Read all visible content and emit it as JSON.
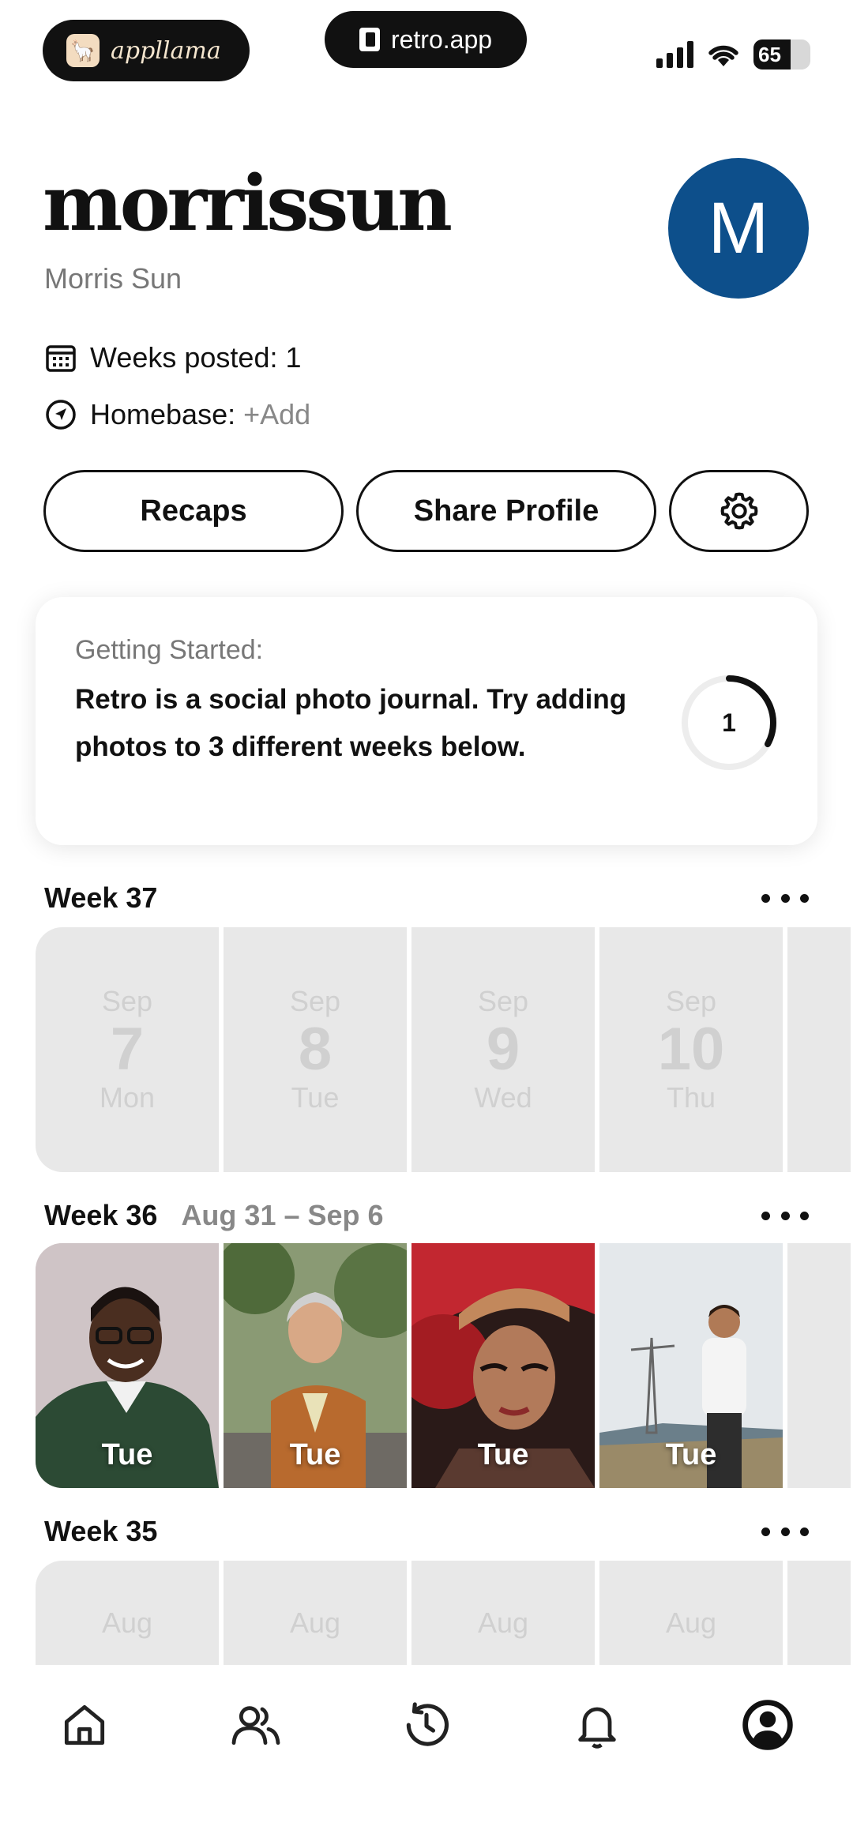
{
  "status_bar": {
    "left_pill_label": "appllama",
    "center_pill_label": "retro.app",
    "battery_level": "65",
    "battery_fraction": 0.65
  },
  "profile": {
    "username": "morrissun",
    "full_name": "Morris Sun",
    "avatar_initial": "M",
    "avatar_color": "#0d4f8b",
    "weeks_posted": "Weeks posted: 1",
    "homebase_label": "Homebase:",
    "homebase_action": "+Add"
  },
  "actions": {
    "recaps_label": "Recaps",
    "share_label": "Share Profile"
  },
  "getting_started": {
    "title": "Getting Started:",
    "body": "Retro is a social photo journal. Try adding photos to 3 different weeks below.",
    "progress_value": "1",
    "progress_fraction": 0.33
  },
  "weeks": [
    {
      "label": "Week 37",
      "range": "",
      "days": [
        {
          "month": "Sep",
          "day": "7",
          "dow": "Mon"
        },
        {
          "month": "Sep",
          "day": "8",
          "dow": "Tue"
        },
        {
          "month": "Sep",
          "day": "9",
          "dow": "Wed"
        },
        {
          "month": "Sep",
          "day": "10",
          "dow": "Thu"
        }
      ]
    },
    {
      "label": "Week 36",
      "range": "Aug 31 – Sep 6",
      "photos": [
        {
          "dow": "Tue"
        },
        {
          "dow": "Tue"
        },
        {
          "dow": "Tue"
        },
        {
          "dow": "Tue"
        }
      ]
    },
    {
      "label": "Week 35",
      "range": "",
      "days": [
        {
          "month": "Aug"
        },
        {
          "month": "Aug"
        },
        {
          "month": "Aug"
        },
        {
          "month": "Aug"
        }
      ]
    }
  ],
  "tabbar": {
    "icons": [
      "home-icon",
      "friends-icon",
      "history-icon",
      "bell-icon",
      "profile-icon"
    ],
    "active": "profile-icon"
  }
}
